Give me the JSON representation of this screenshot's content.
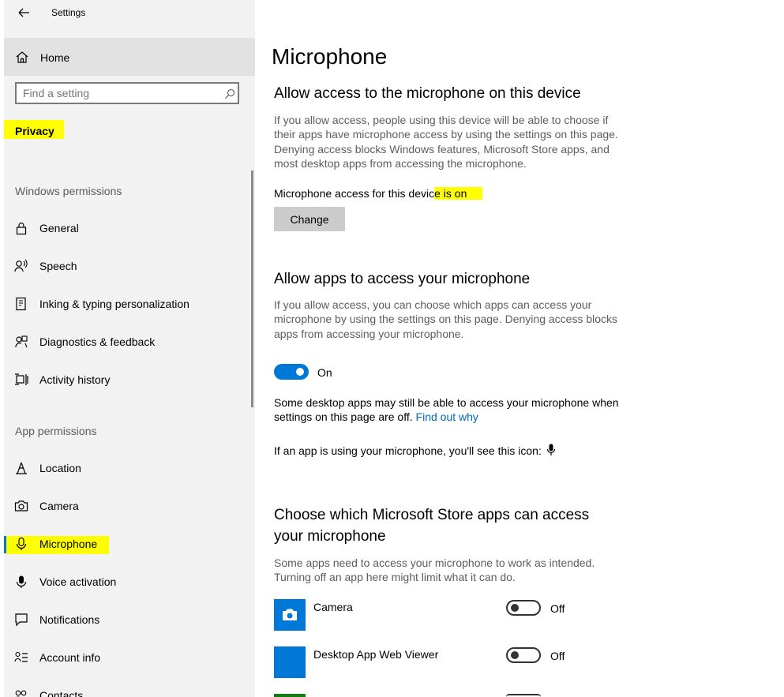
{
  "window": {
    "title": "Settings"
  },
  "sidebar": {
    "home_label": "Home",
    "search_placeholder": "Find a setting",
    "category": "Privacy",
    "windows_permissions_heading": "Windows permissions",
    "windows_permissions": [
      {
        "label": "General",
        "icon": "lock-icon"
      },
      {
        "label": "Speech",
        "icon": "speech-icon"
      },
      {
        "label": "Inking & typing personalization",
        "icon": "inking-icon"
      },
      {
        "label": "Diagnostics & feedback",
        "icon": "diagnostics-icon"
      },
      {
        "label": "Activity history",
        "icon": "activity-history-icon"
      }
    ],
    "app_permissions_heading": "App permissions",
    "app_permissions": [
      {
        "label": "Location",
        "icon": "location-icon"
      },
      {
        "label": "Camera",
        "icon": "camera-icon"
      },
      {
        "label": "Microphone",
        "icon": "microphone-icon",
        "selected": true
      },
      {
        "label": "Voice activation",
        "icon": "voice-activation-icon"
      },
      {
        "label": "Notifications",
        "icon": "notifications-icon"
      },
      {
        "label": "Account info",
        "icon": "account-info-icon"
      },
      {
        "label": "Contacts",
        "icon": "contacts-icon"
      }
    ]
  },
  "main": {
    "page_title": "Microphone",
    "device_section": {
      "heading": "Allow access to the microphone on this device",
      "description": "If you allow access, people using this device will be able to choose if their apps have microphone access by using the settings on this page. Denying access blocks Windows features, Microsoft Store apps, and most desktop apps from accessing the microphone.",
      "status_prefix": "Microphone access for this devic",
      "status_highlight_a": "e",
      "status_highlight_b": " is on",
      "change_button": "Change"
    },
    "apps_section": {
      "heading": "Allow apps to access your microphone",
      "description": "If you allow access, you can choose which apps can access your microphone by using the settings on this page. Denying access blocks apps from accessing your microphone.",
      "toggle_state": "On",
      "desktop_note": "Some desktop apps may still be able to access your microphone when settings on this page are off.",
      "find_out_why": "Find out why",
      "icon_note": "If an app is using your microphone, you'll see this icon:"
    },
    "store_section": {
      "heading_line1": "Choose which Microsoft Store apps can access",
      "heading_line2": "your microphone",
      "description": "Some apps need to access your microphone to work as intended. Turning off an app here might limit what it can do.",
      "apps": [
        {
          "name": "Camera",
          "state": "Off"
        },
        {
          "name": "Desktop App Web Viewer",
          "state": "Off"
        }
      ]
    }
  },
  "colors": {
    "accent": "#0078d7",
    "highlight": "#ffff00",
    "link": "#0067c0",
    "sidebar_bg": "#f2f2f2"
  }
}
